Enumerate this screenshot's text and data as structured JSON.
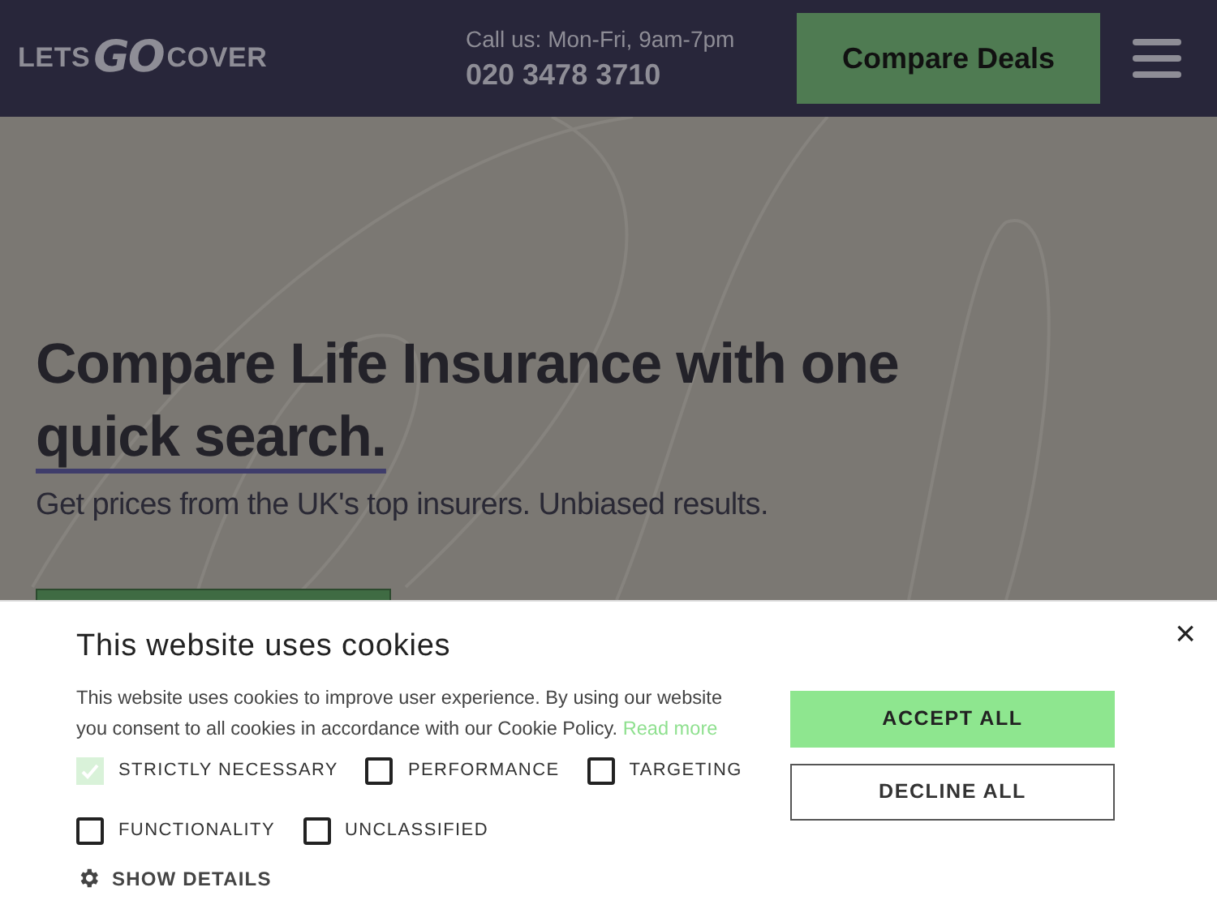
{
  "header": {
    "logo": {
      "parts": [
        "LETS",
        "GO",
        "COVER"
      ]
    },
    "call_hours": "Call us: Mon-Fri, 9am-7pm",
    "phone": "020 3478 3710",
    "cta": "Compare Deals"
  },
  "hero": {
    "headline": "Compare Life Insurance with one",
    "highlight": "quick search.",
    "subheading": "Get prices from the UK's top insurers. Unbiased results."
  },
  "cookie_banner": {
    "title": "This website uses cookies",
    "body": "This website uses cookies to improve user experience. By using our website you consent to all cookies in accordance with our Cookie Policy.",
    "link": "Read more",
    "options": [
      {
        "label": "STRICTLY NECESSARY",
        "checked": true,
        "disabled": true
      },
      {
        "label": "PERFORMANCE",
        "checked": false,
        "disabled": false
      },
      {
        "label": "TARGETING",
        "checked": false,
        "disabled": false
      },
      {
        "label": "FUNCTIONALITY",
        "checked": false,
        "disabled": false
      },
      {
        "label": "UNCLASSIFIED",
        "checked": false,
        "disabled": false
      }
    ],
    "show_details": "SHOW DETAILS",
    "buttons": [
      {
        "label": "ACCEPT ALL",
        "kind": "primary"
      },
      {
        "label": "DECLINE ALL",
        "kind": "outline"
      }
    ],
    "close": "×"
  }
}
